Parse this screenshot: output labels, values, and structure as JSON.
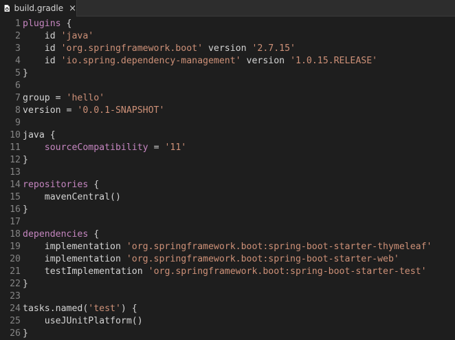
{
  "tab": {
    "filename": "build.gradle",
    "icon": "gradle-file-icon",
    "close_icon": "close-icon",
    "close_glyph": "×"
  },
  "colors": {
    "background": "#1e1e1e",
    "line_number": "#858585",
    "keyword": "#c586c0",
    "identifier": "#d4d4d4",
    "string": "#ce9178"
  },
  "lines": [
    {
      "n": "1",
      "tokens": [
        {
          "t": "kw",
          "v": "plugins"
        },
        {
          "t": "punct",
          "v": " {"
        }
      ]
    },
    {
      "n": "2",
      "tokens": [
        {
          "t": "id",
          "v": "    id "
        },
        {
          "t": "str",
          "v": "'java'"
        }
      ]
    },
    {
      "n": "3",
      "tokens": [
        {
          "t": "id",
          "v": "    id "
        },
        {
          "t": "str",
          "v": "'org.springframework.boot'"
        },
        {
          "t": "id",
          "v": " version "
        },
        {
          "t": "str",
          "v": "'2.7.15'"
        }
      ]
    },
    {
      "n": "4",
      "tokens": [
        {
          "t": "id",
          "v": "    id "
        },
        {
          "t": "str",
          "v": "'io.spring.dependency-management'"
        },
        {
          "t": "id",
          "v": " version "
        },
        {
          "t": "str",
          "v": "'1.0.15.RELEASE'"
        }
      ]
    },
    {
      "n": "5",
      "tokens": [
        {
          "t": "punct",
          "v": "}"
        }
      ]
    },
    {
      "n": "6",
      "tokens": []
    },
    {
      "n": "7",
      "tokens": [
        {
          "t": "id",
          "v": "group = "
        },
        {
          "t": "str",
          "v": "'hello'"
        }
      ]
    },
    {
      "n": "8",
      "tokens": [
        {
          "t": "id",
          "v": "version = "
        },
        {
          "t": "str",
          "v": "'0.0.1-SNAPSHOT'"
        }
      ]
    },
    {
      "n": "9",
      "tokens": []
    },
    {
      "n": "10",
      "tokens": [
        {
          "t": "id",
          "v": "java {"
        }
      ]
    },
    {
      "n": "11",
      "tokens": [
        {
          "t": "kw",
          "v": "    sourceCompatibility"
        },
        {
          "t": "id",
          "v": " = "
        },
        {
          "t": "str",
          "v": "'11'"
        }
      ]
    },
    {
      "n": "12",
      "tokens": [
        {
          "t": "punct",
          "v": "}"
        }
      ]
    },
    {
      "n": "13",
      "tokens": []
    },
    {
      "n": "14",
      "tokens": [
        {
          "t": "kw",
          "v": "repositories"
        },
        {
          "t": "punct",
          "v": " {"
        }
      ]
    },
    {
      "n": "15",
      "tokens": [
        {
          "t": "id",
          "v": "    mavenCentral()"
        }
      ]
    },
    {
      "n": "16",
      "tokens": [
        {
          "t": "punct",
          "v": "}"
        }
      ]
    },
    {
      "n": "17",
      "tokens": []
    },
    {
      "n": "18",
      "tokens": [
        {
          "t": "kw",
          "v": "dependencies"
        },
        {
          "t": "punct",
          "v": " {"
        }
      ]
    },
    {
      "n": "19",
      "tokens": [
        {
          "t": "id",
          "v": "    implementation "
        },
        {
          "t": "str",
          "v": "'org.springframework.boot:spring-boot-starter-thymeleaf'"
        }
      ]
    },
    {
      "n": "20",
      "tokens": [
        {
          "t": "id",
          "v": "    implementation "
        },
        {
          "t": "str",
          "v": "'org.springframework.boot:spring-boot-starter-web'"
        }
      ]
    },
    {
      "n": "21",
      "tokens": [
        {
          "t": "id",
          "v": "    testImplementation "
        },
        {
          "t": "str",
          "v": "'org.springframework.boot:spring-boot-starter-test'"
        }
      ]
    },
    {
      "n": "22",
      "tokens": [
        {
          "t": "punct",
          "v": "}"
        }
      ]
    },
    {
      "n": "23",
      "tokens": []
    },
    {
      "n": "24",
      "tokens": [
        {
          "t": "id",
          "v": "tasks.named("
        },
        {
          "t": "str",
          "v": "'test'"
        },
        {
          "t": "id",
          "v": ") {"
        }
      ]
    },
    {
      "n": "25",
      "tokens": [
        {
          "t": "id",
          "v": "    useJUnitPlatform()"
        }
      ]
    },
    {
      "n": "26",
      "tokens": [
        {
          "t": "punct",
          "v": "}"
        }
      ]
    }
  ]
}
